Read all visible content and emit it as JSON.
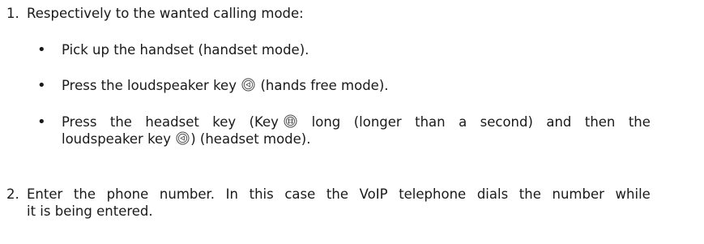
{
  "document": {
    "step1": {
      "number": "1.",
      "text": "Respectively to the wanted calling mode:"
    },
    "bullets": [
      {
        "symbol": "•",
        "text": "Pick up the handset (handset mode)."
      },
      {
        "symbol": "•",
        "text_before": "Press the loudspeaker key",
        "icon": "loudspeaker-key-icon",
        "text_after": "(hands free mode)."
      },
      {
        "symbol": "•",
        "line1_words": [
          "Press",
          "the",
          "headset",
          "key",
          "(Key",
          "long",
          "(longer",
          "than",
          "a",
          "second)",
          "and",
          "then",
          "the"
        ],
        "icon_headset": "headset-key-icon",
        "line2_before": "loudspeaker key",
        "icon_loudspeaker": "loudspeaker-key-icon",
        "line2_after": ") (headset mode)."
      }
    ],
    "step2": {
      "number": "2.",
      "line1_words": [
        "Enter",
        "the",
        "phone",
        "number.",
        "In",
        "this",
        "case",
        "the",
        "VoIP",
        "telephone",
        "dials",
        "the",
        "number",
        "while"
      ],
      "line2": "it is being entered."
    }
  }
}
